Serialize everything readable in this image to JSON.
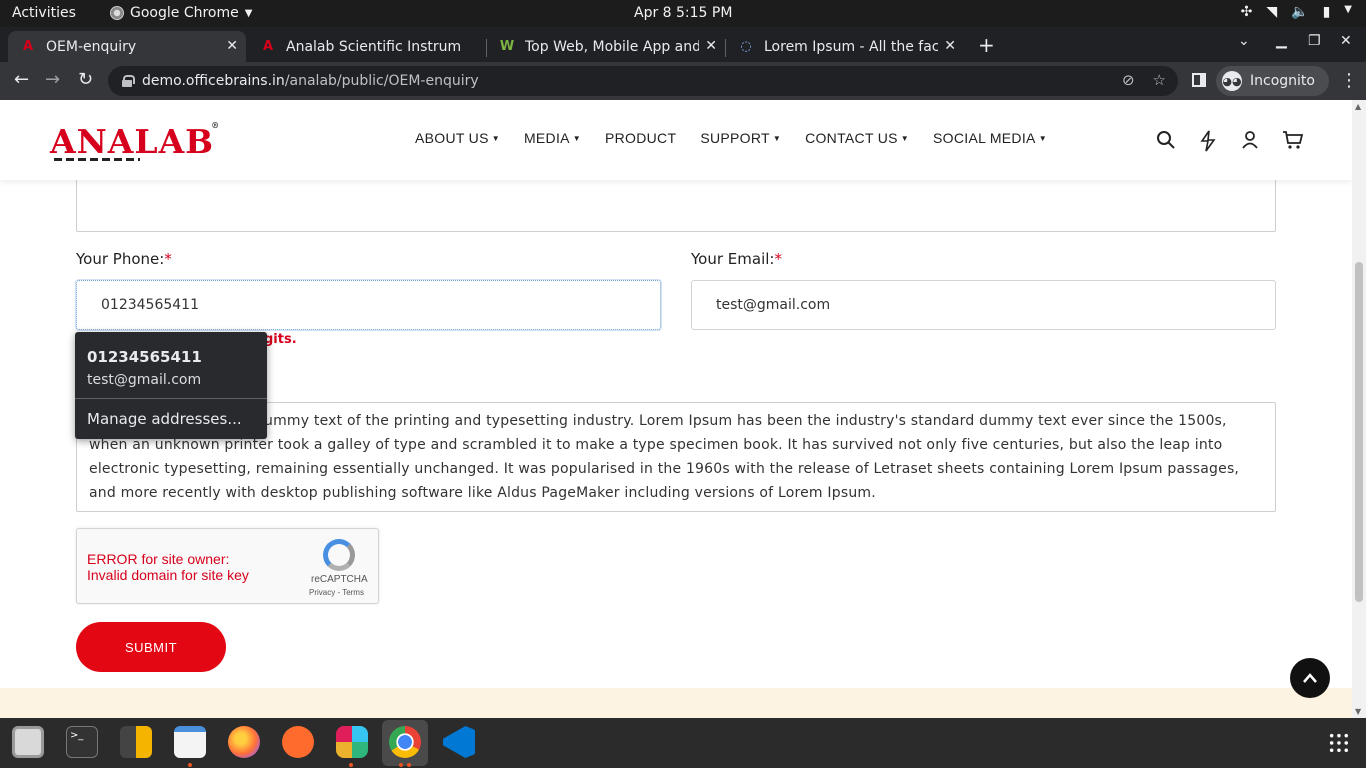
{
  "system": {
    "activities": "Activities",
    "app_name": "Google Chrome",
    "clock": "Apr 8  5:15 PM"
  },
  "tabs": [
    {
      "title": "OEM-enquiry",
      "active": true
    },
    {
      "title": "Analab Scientific Instrume",
      "active": false
    },
    {
      "title": "Top Web, Mobile App and",
      "active": false
    },
    {
      "title": "Lorem Ipsum - All the fact",
      "active": false
    }
  ],
  "omnibox": {
    "host": "demo.officebrains.in",
    "path": "/analab/public/OEM-enquiry",
    "incognito_label": "Incognito"
  },
  "site": {
    "logo": "ANALAB",
    "menu": [
      {
        "label": "ABOUT US",
        "dropdown": true
      },
      {
        "label": "MEDIA",
        "dropdown": true
      },
      {
        "label": "PRODUCT",
        "dropdown": false
      },
      {
        "label": "SUPPORT",
        "dropdown": true
      },
      {
        "label": "CONTACT US",
        "dropdown": true
      },
      {
        "label": "SOCIAL MEDIA",
        "dropdown": true
      }
    ]
  },
  "form": {
    "phone_label": "Your Phone:",
    "phone_value": "01234565411",
    "email_label": "Your Email:",
    "email_value": "test@gmail.com",
    "required_mark": "*",
    "phone_error_visible": "gits.",
    "message_text": "Lorem Ipsum is simply dummy text of the printing and typesetting industry. Lorem Ipsum has been the industry's standard dummy text ever since the 1500s, when an unknown printer took a galley of type and scrambled it to make a type specimen book. It has survived not only five centuries, but also the leap into electronic typesetting, remaining essentially unchanged. It was popularised in the 1960s with the release of Letraset sheets containing Lorem Ipsum passages, and more recently with desktop publishing software like Aldus PageMaker including versions of Lorem Ipsum.",
    "captcha_error_line1": "ERROR for site owner:",
    "captcha_error_line2": "Invalid domain for site key",
    "captcha_brand": "reCAPTCHA",
    "captcha_terms": "Privacy - Terms",
    "submit_label": "SUBMIT"
  },
  "autofill": {
    "primary": "01234565411",
    "secondary": "test@gmail.com",
    "manage": "Manage addresses..."
  },
  "colors": {
    "brand_red": "#d6001c",
    "submit_red": "#e30613",
    "chrome_dark": "#202124"
  }
}
